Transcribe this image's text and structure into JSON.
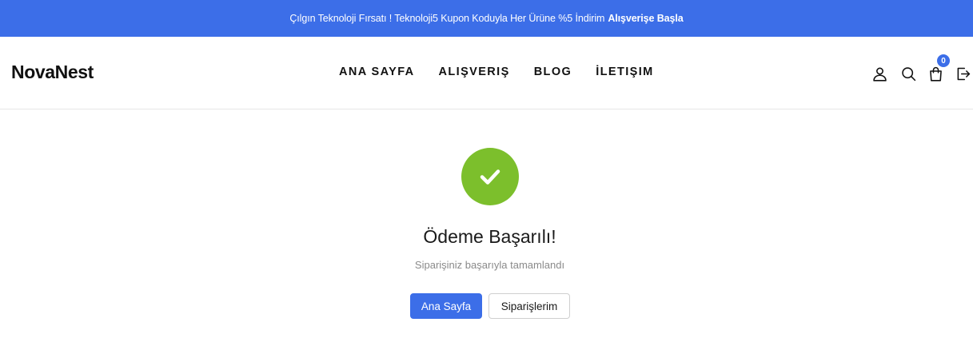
{
  "promo": {
    "text": "Çılgın Teknoloji Fırsatı ! Teknoloji5 Kupon Koduyla Her Ürüne %5 İndirim",
    "cta": "Alışverişe Başla"
  },
  "header": {
    "logo": "NovaNest",
    "nav": [
      "ANA SAYFA",
      "ALIŞVERIŞ",
      "BLOG",
      "İLETIŞIM"
    ],
    "cart_count": "0"
  },
  "main": {
    "title": "Ödeme Başarılı!",
    "subtitle": "Siparişiniz başarıyla tamamlandı",
    "primary_button": "Ana Sayfa",
    "secondary_button": "Siparişlerim"
  },
  "colors": {
    "accent": "#3c6ee8",
    "success": "#7cbf2c"
  }
}
